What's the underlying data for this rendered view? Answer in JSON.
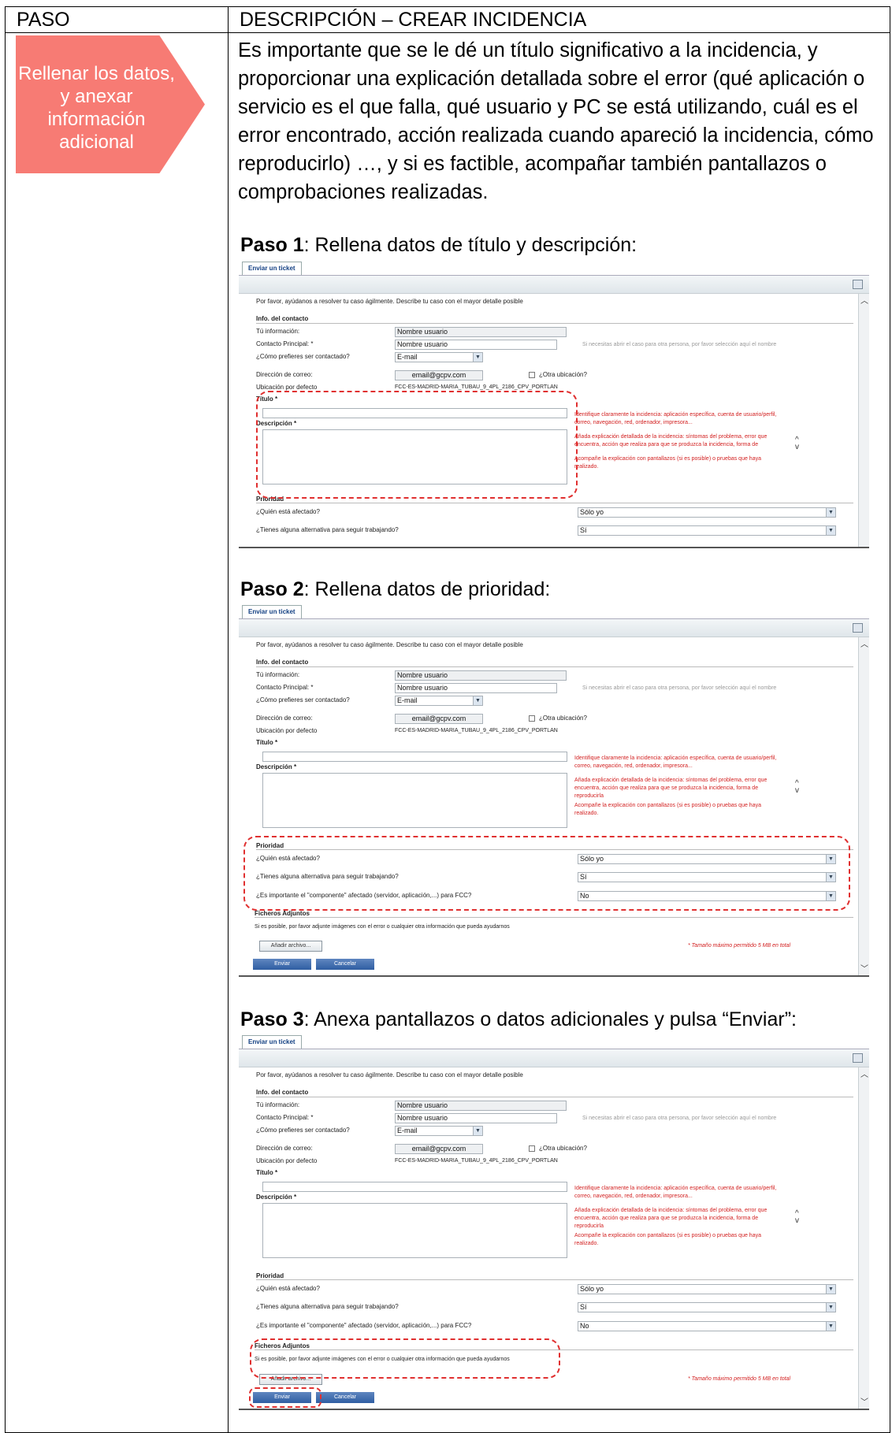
{
  "header": {
    "col1": "PASO",
    "col2": "DESCRIPCIÓN – CREAR INCIDENCIA"
  },
  "step_arrow": {
    "label": "Rellenar los datos, y anexar información adicional",
    "color": "#f77b74"
  },
  "intro": "Es importante que se le dé un título significativo a la incidencia, y proporcionar una explicación detallada sobre el error (qué aplicación o servicio es el que falla, qué usuario y PC se está utilizando, cuál es el error encontrado, acción realizada cuando apareció la incidencia, cómo reproducirlo) …, y si es factible, acompañar también pantallazos o comprobaciones realizadas.",
  "steps": [
    {
      "title_bold": "Paso 1",
      "title_rest": ": Rellena datos de título y descripción:"
    },
    {
      "title_bold": "Paso 2",
      "title_rest": ": Rellena datos de prioridad:"
    },
    {
      "title_bold": "Paso 3",
      "title_rest": ": Anexa pantallazos o datos adicionales y pulsa “Enviar”:"
    }
  ],
  "form": {
    "tab": "Enviar un ticket",
    "intro": "Por favor, ayúdanos a resolver tu caso ágilmente. Describe tu caso con el mayor detalle posible",
    "contact_section": "Info. del contacto",
    "tu_info_label": "Tú información:",
    "tu_info_value": "Nombre usuario",
    "contacto_label": "Contacto Principal: *",
    "contacto_value": "Nombre usuario",
    "contacto_hint": "Si necesitas abrir el caso para otra persona, por favor selección aquí el nombre",
    "como_label": "¿Cómo prefieres ser contactado?",
    "como_value": "E-mail",
    "correo_label": "Dirección de correo:",
    "correo_value": "email@gcpv.com",
    "otra_ubicacion": "¿Otra ubicación?",
    "ubicacion_label": "Ubicación por defecto",
    "ubicacion_value": "FCC-ES-MADRID-MARIA_TUBAU_9_4PL_2186_CPV_PORTLAN",
    "titulo_label": "Título *",
    "descripcion_label": "Descripción *",
    "hint1": "Identifique claramente la incidencia: aplicación específica, cuenta de usuario/perfil,",
    "hint1b": "correo, navegación, red, ordenador, impresora...",
    "hint2": "Añada explicación detallada de la incidencia: síntomas del problema, error que",
    "hint2b": "encuentra, acción que realiza para que se produzca la incidencia, forma de",
    "hint2c": "reproducirla",
    "hint3": "Acompañe la explicación con pantallazos (si es posible) o pruebas que haya",
    "hint3b": "realizado.",
    "prioridad": "Prioridad",
    "quien_label": "¿Quién está afectado?",
    "quien_value": "Sólo yo",
    "alternativa_label": "¿Tienes alguna alternativa para seguir trabajando?",
    "alternativa_value": "Sí",
    "componente_label": "¿Es importante el \"componente\" afectado (servidor, aplicación,...) para FCC?",
    "componente_value": "No",
    "ficheros": "Ficheros Adjuntos",
    "ficheros_hint": "Si es posible, por favor adjunte imágenes con el error o cualquier otra información que pueda ayudarnos",
    "anadir": "Añadir archivo...",
    "tamano": "* Tamaño máximo permitido 5 MB en total",
    "enviar": "Enviar",
    "cancelar": "Cancelar"
  }
}
